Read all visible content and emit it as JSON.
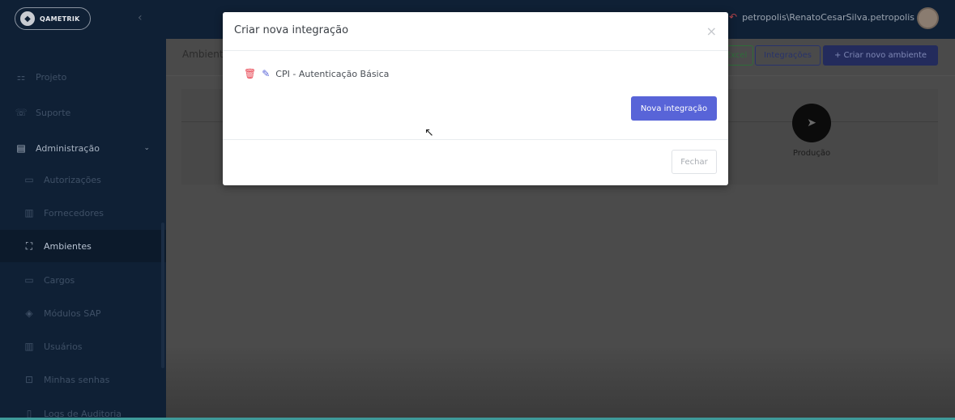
{
  "brand": {
    "name": "QAMETRIK"
  },
  "sidebar": {
    "items": [
      {
        "label": "Projeto",
        "icon": "project-icon"
      },
      {
        "label": "Suporte",
        "icon": "support-icon"
      },
      {
        "label": "Administração",
        "icon": "admin-icon"
      },
      {
        "label": "Autorizações",
        "icon": "folder-icon"
      },
      {
        "label": "Fornecedores",
        "icon": "building-icon"
      },
      {
        "label": "Ambientes",
        "icon": "sitemap-icon"
      },
      {
        "label": "Cargos",
        "icon": "folder-icon"
      },
      {
        "label": "Módulos SAP",
        "icon": "layers-icon"
      },
      {
        "label": "Usuários",
        "icon": "building-icon"
      },
      {
        "label": "Minhas senhas",
        "icon": "lock-icon"
      },
      {
        "label": "Logs de Auditoria",
        "icon": "document-icon"
      }
    ]
  },
  "header": {
    "user": "petropolis\\RenatoCesarSilva.petropolis"
  },
  "page": {
    "title": "Ambientes",
    "buttons": {
      "excel": "Excel",
      "integrations": "Integrações",
      "new_env": "+ Criar novo ambiente"
    },
    "environment": {
      "label": "Produção",
      "icon": "rocket-icon"
    }
  },
  "modal": {
    "title": "Criar nova integração",
    "integrations": [
      {
        "name": "CPI - Autenticação Básica"
      }
    ],
    "new_button": "Nova integração",
    "close_button": "Fechar"
  },
  "colors": {
    "primary": "#5864d8",
    "danger": "#e8424f",
    "sidebar": "#0f2035"
  }
}
